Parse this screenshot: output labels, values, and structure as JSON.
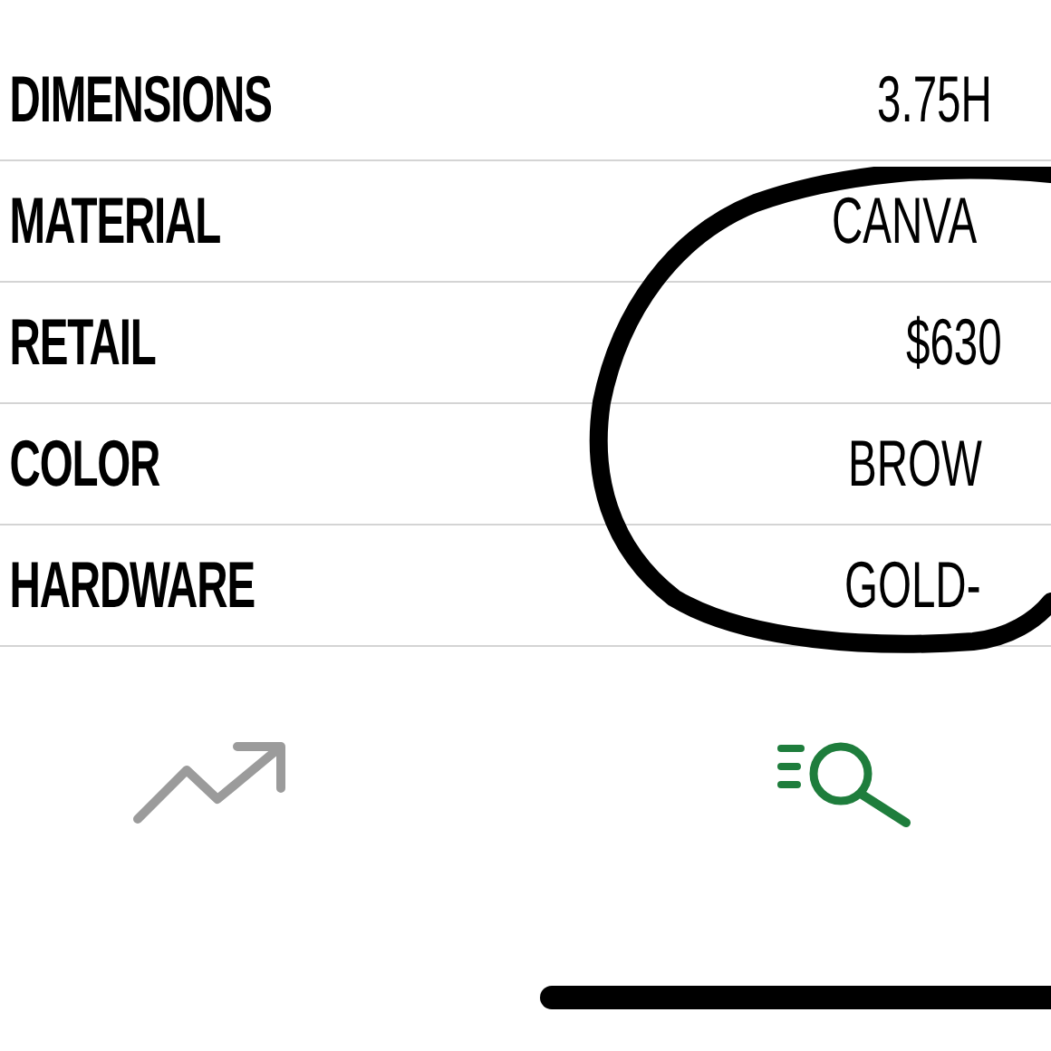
{
  "specs": [
    {
      "label": "DIMENSIONS",
      "value": "3.75H"
    },
    {
      "label": "MATERIAL",
      "value": "CANVA"
    },
    {
      "label": "RETAIL",
      "value": "$630"
    },
    {
      "label": "COLOR",
      "value": "BROW"
    },
    {
      "label": "HARDWARE",
      "value": "GOLD-"
    }
  ],
  "tab_bar": [
    {
      "kind": "trends",
      "selected": false
    },
    {
      "kind": "search",
      "selected": true
    }
  ]
}
